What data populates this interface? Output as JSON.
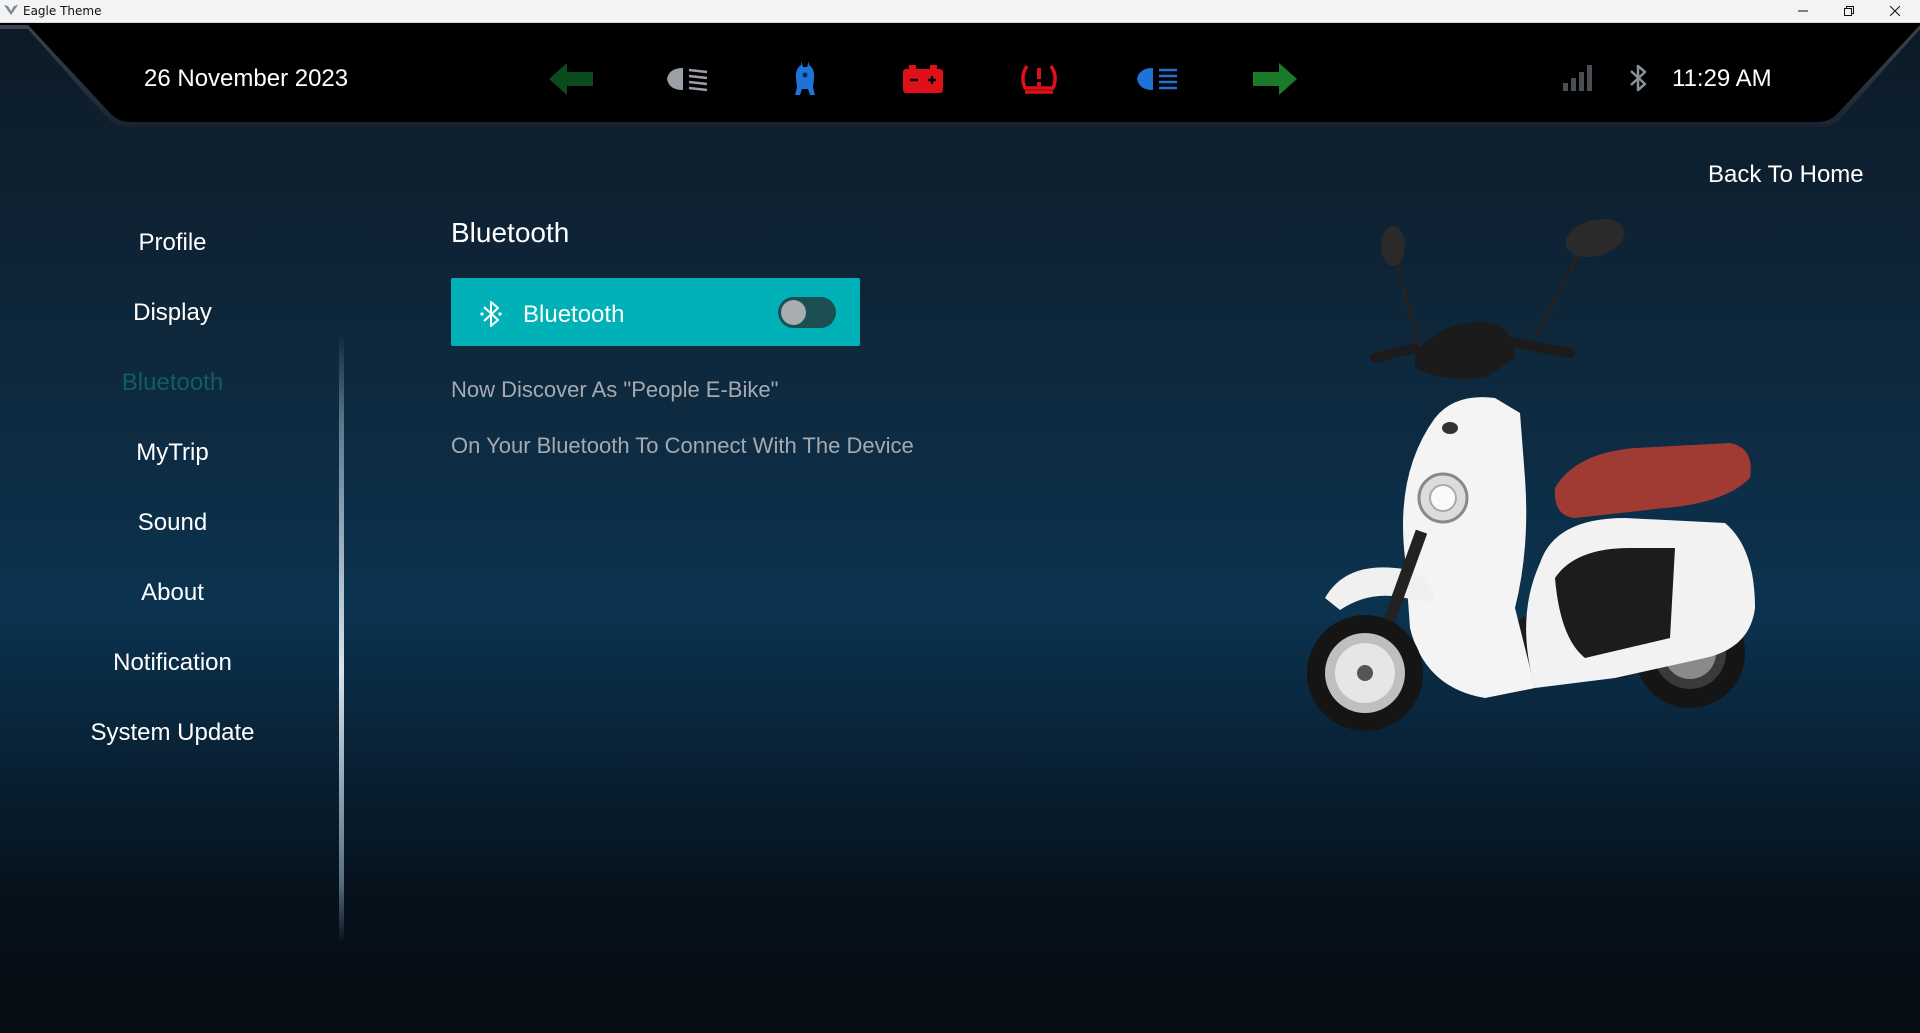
{
  "window": {
    "title": "Eagle Theme",
    "icon": "eagle-logo-icon",
    "controls": [
      "minimize-icon",
      "maximize-icon",
      "close-icon"
    ]
  },
  "header": {
    "date": "26 November 2023",
    "time": "11:29 AM",
    "status_icons": [
      {
        "name": "left-turn-signal-icon",
        "color": "#0b4a1c"
      },
      {
        "name": "low-beam-headlight-icon",
        "color": "#9aa0a6"
      },
      {
        "name": "kickstand-icon",
        "color": "#1e73d8"
      },
      {
        "name": "battery-warning-icon",
        "color": "#e0101a"
      },
      {
        "name": "tire-pressure-warning-icon",
        "color": "#e0101a"
      },
      {
        "name": "high-beam-headlight-icon",
        "color": "#1e73d8"
      },
      {
        "name": "right-turn-signal-icon",
        "color": "#1a7a2a"
      }
    ],
    "signal_icon": "signal-bars-icon",
    "bluetooth_icon": "bluetooth-icon"
  },
  "back_home_label": "Back To Home",
  "sidebar": {
    "items": [
      {
        "label": "Profile",
        "active": false
      },
      {
        "label": "Display",
        "active": false
      },
      {
        "label": "Bluetooth",
        "active": true
      },
      {
        "label": "MyTrip",
        "active": false
      },
      {
        "label": "Sound",
        "active": false
      },
      {
        "label": "About",
        "active": false
      },
      {
        "label": "Notification",
        "active": false
      },
      {
        "label": "System Update",
        "active": false
      }
    ]
  },
  "main": {
    "title": "Bluetooth",
    "toggle_card": {
      "label": "Bluetooth",
      "icon": "bluetooth-icon",
      "enabled": false
    },
    "discover_text": "Now Discover As \"People E-Bike\"",
    "instruction_text": "On Your Bluetooth To Connect With The Device"
  },
  "colors": {
    "accent": "#00b2b8",
    "active_menu": "#0e5f5e",
    "info_text": "#a4aab0"
  },
  "image": {
    "name": "scooter-image"
  }
}
